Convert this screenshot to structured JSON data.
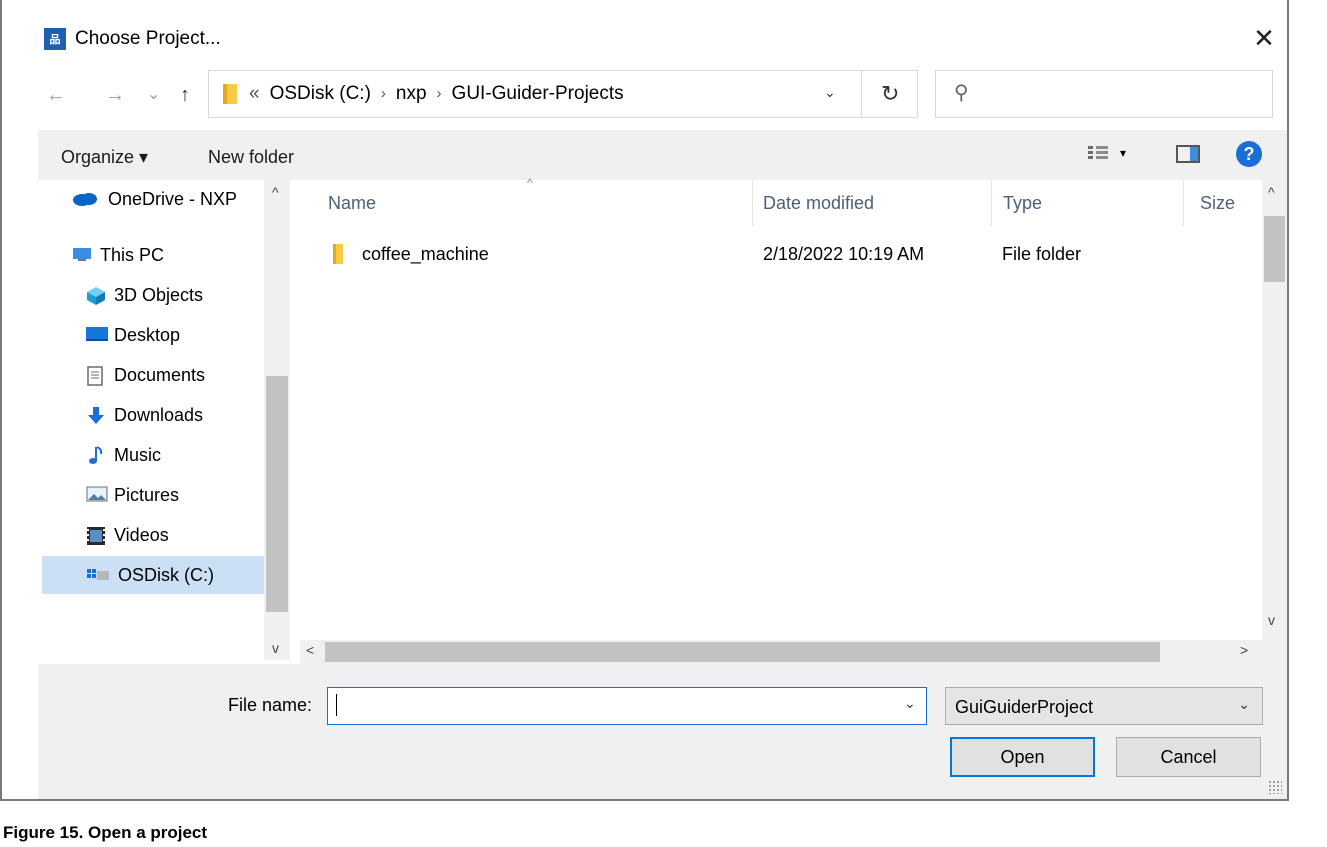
{
  "window": {
    "title": "Choose Project...",
    "app_icon_text": "品"
  },
  "nav_buttons": {
    "back": "←",
    "forward": "→",
    "recent": "⌄",
    "up": "↑"
  },
  "address_bar": {
    "overflow": "«",
    "crumbs": [
      "OSDisk (C:)",
      "nxp",
      "GUI-Guider-Projects"
    ],
    "separator": "›",
    "dropdown": "⌄",
    "refresh": "↻"
  },
  "search": {
    "placeholder": "",
    "icon": "search-icon"
  },
  "toolbar": {
    "organize_label": "Organize ▾",
    "new_folder_label": "New folder",
    "view_caret": "▾",
    "help": "?"
  },
  "navigation_pane": {
    "items": [
      {
        "label": "OneDrive - NXP",
        "icon": "onedrive-icon"
      },
      {
        "label": "This PC",
        "icon": "this-pc-icon"
      },
      {
        "label": "3D Objects",
        "icon": "3d-objects-icon"
      },
      {
        "label": "Desktop",
        "icon": "desktop-icon"
      },
      {
        "label": "Documents",
        "icon": "documents-icon"
      },
      {
        "label": "Downloads",
        "icon": "downloads-icon"
      },
      {
        "label": "Music",
        "icon": "music-icon"
      },
      {
        "label": "Pictures",
        "icon": "pictures-icon"
      },
      {
        "label": "Videos",
        "icon": "videos-icon"
      },
      {
        "label": "OSDisk (C:)",
        "icon": "drive-icon",
        "selected": true
      }
    ]
  },
  "file_list": {
    "columns": [
      "Name",
      "Date modified",
      "Type",
      "Size"
    ],
    "rows": [
      {
        "name": "coffee_machine",
        "date_modified": "2/18/2022 10:19 AM",
        "type": "File folder",
        "size": ""
      }
    ]
  },
  "scroll_arrows": {
    "up": "^",
    "down": "v",
    "left": "<",
    "right": ">",
    "sort": "^"
  },
  "bottom": {
    "file_name_label": "File name:",
    "file_name_value": "",
    "file_name_dropdown": "⌄",
    "file_type": "GuiGuiderProject",
    "file_type_dropdown": "⌄",
    "open_label": "Open",
    "cancel_label": "Cancel"
  },
  "caption": "Figure 15.  Open a project",
  "colors": {
    "accent": "#0078d7",
    "selection": "#cce0f5",
    "toolbar_bg": "#f0f0f0",
    "folder": "#f8c945"
  }
}
